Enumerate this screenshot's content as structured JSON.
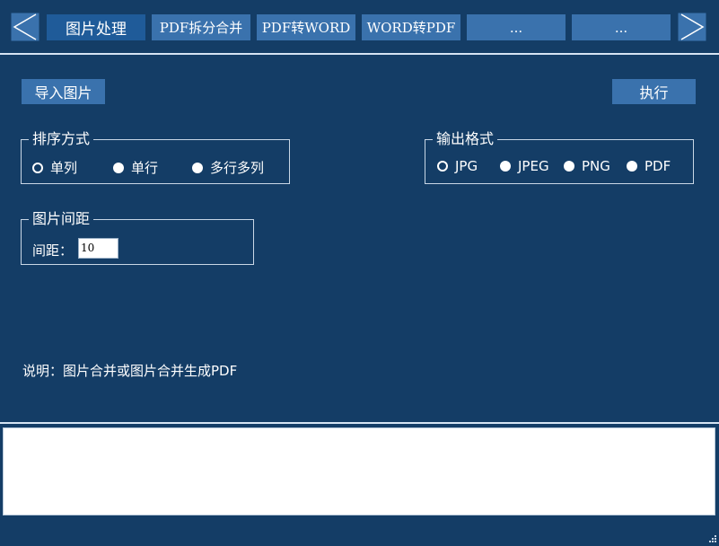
{
  "nav": {
    "prev_icon": "chevron-left-icon",
    "next_icon": "chevron-right-icon",
    "tabs": [
      {
        "label": "图片处理",
        "active": true
      },
      {
        "label": "PDF拆分合并",
        "active": false
      },
      {
        "label": "PDF转WORD",
        "active": false
      },
      {
        "label": "WORD转PDF",
        "active": false
      },
      {
        "label": "...",
        "active": false
      },
      {
        "label": "...",
        "active": false
      }
    ]
  },
  "toolbar": {
    "import_label": "导入图片",
    "execute_label": "执行"
  },
  "sort": {
    "title": "排序方式",
    "options": [
      {
        "label": "单列",
        "checked": true
      },
      {
        "label": "单行",
        "checked": false
      },
      {
        "label": "多行多列",
        "checked": false
      }
    ]
  },
  "format": {
    "title": "输出格式",
    "options": [
      {
        "label": "JPG",
        "checked": true
      },
      {
        "label": "JPEG",
        "checked": false
      },
      {
        "label": "PNG",
        "checked": false
      },
      {
        "label": "PDF",
        "checked": false
      }
    ]
  },
  "spacing": {
    "title": "图片间距",
    "label": "间距：",
    "value": "10"
  },
  "description": "说明：图片合并或图片合并生成PDF",
  "output": {
    "text": ""
  },
  "colors": {
    "background": "#143d66",
    "button": "#3a72ad",
    "active_tab": "#1f5b99"
  }
}
